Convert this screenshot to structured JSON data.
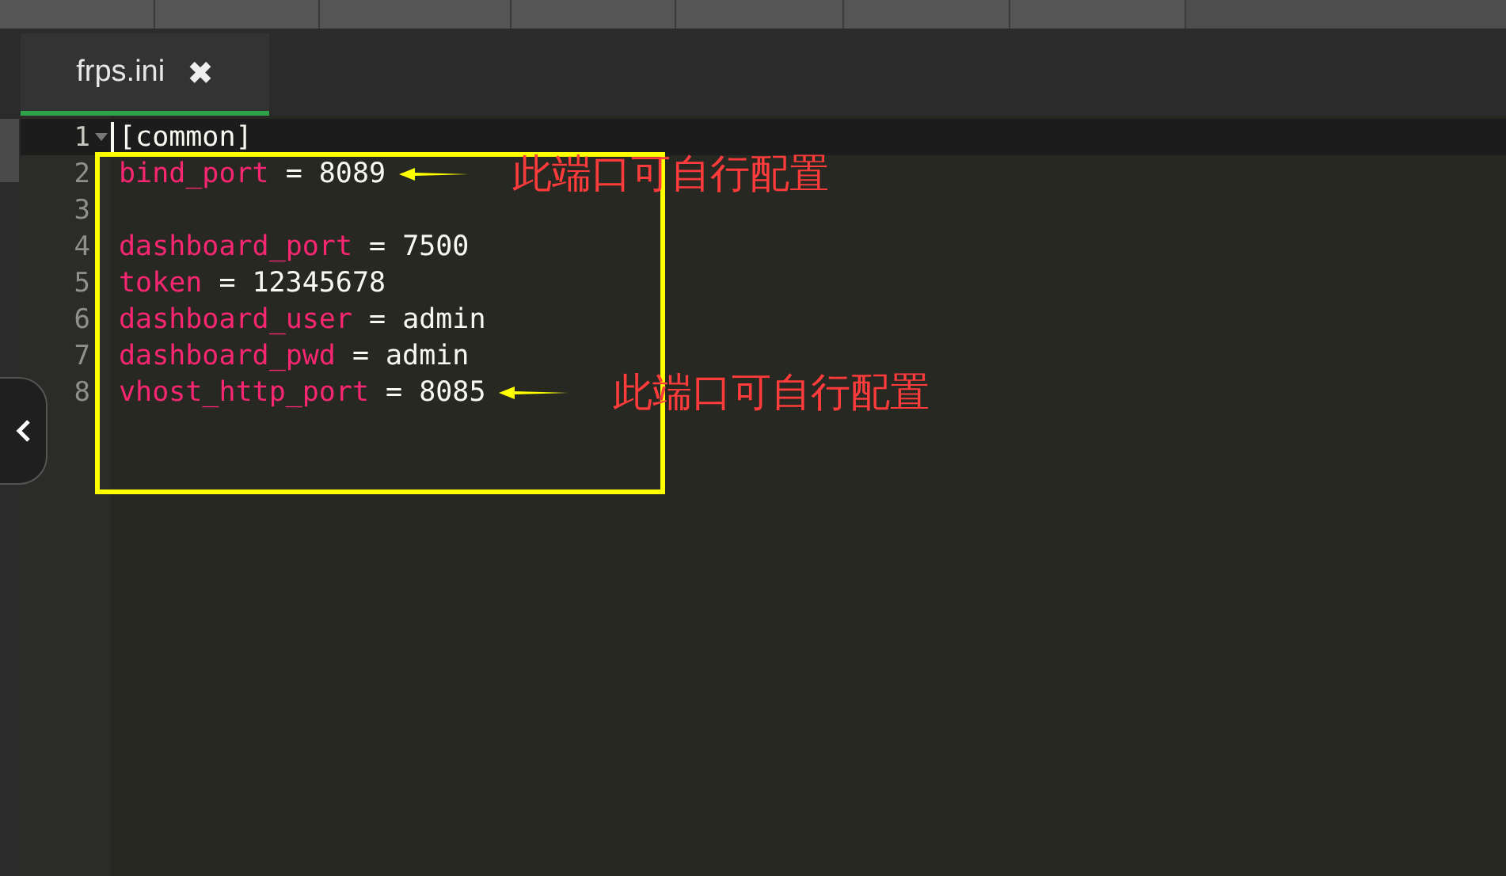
{
  "tab": {
    "label": "frps.ini",
    "close": "✖",
    "selected": true
  },
  "lines": [
    {
      "num": "1",
      "kind": "section",
      "text": "[common]",
      "active": true,
      "foldable": true
    },
    {
      "num": "2",
      "kind": "pair",
      "key": "bind_port",
      "sep": "=",
      "value": "8089",
      "active": false,
      "foldable": false,
      "note": "此端口可自行配置"
    },
    {
      "num": "3",
      "kind": "blank",
      "active": false,
      "foldable": false
    },
    {
      "num": "4",
      "kind": "pair",
      "key": "dashboard_port",
      "sep": "=",
      "value": "7500",
      "active": false,
      "foldable": false
    },
    {
      "num": "5",
      "kind": "pair",
      "key": "token",
      "sep": "=",
      "value": "12345678",
      "active": false,
      "foldable": false
    },
    {
      "num": "6",
      "kind": "pair",
      "key": "dashboard_user",
      "sep": "=",
      "value": "admin",
      "active": false,
      "foldable": false
    },
    {
      "num": "7",
      "kind": "pair",
      "key": "dashboard_pwd",
      "sep": "=",
      "value": "admin",
      "active": false,
      "foldable": false
    },
    {
      "num": "8",
      "kind": "pair",
      "key": "vhost_http_port",
      "sep": "=",
      "value": "8085",
      "active": false,
      "foldable": false,
      "note": "此端口可自行配置"
    }
  ]
}
